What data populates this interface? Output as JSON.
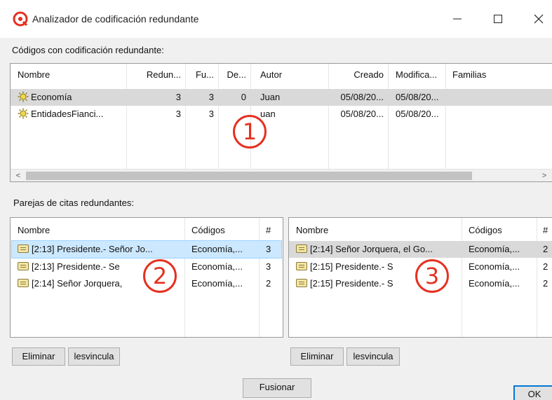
{
  "window": {
    "title": "Analizador de codificación redundante",
    "minimize_icon": "minimize-icon",
    "maximize_icon": "maximize-icon",
    "close_icon": "close-icon",
    "accent_color": "#e53020"
  },
  "codes_section": {
    "label": "Códigos con codificación redundante:",
    "columns": [
      "Nombre",
      "Redun...",
      "Fu...",
      "De...",
      "Autor",
      "Creado",
      "Modifica...",
      "Familias"
    ],
    "rows": [
      {
        "icon": "code-sun-icon",
        "nombre": "Economía",
        "redun": "3",
        "fu": "3",
        "de": "0",
        "autor": "Juan",
        "creado": "05/08/20...",
        "modificado": "05/08/20...",
        "familias": ""
      },
      {
        "icon": "code-sun-icon",
        "nombre": "EntidadesFianci...",
        "redun": "3",
        "fu": "3",
        "de": "",
        "autor": "uan",
        "creado": "05/08/20...",
        "modificado": "05/08/20...",
        "familias": ""
      }
    ]
  },
  "pairs_section": {
    "label": "Parejas de citas redundantes:"
  },
  "left_list": {
    "columns": [
      "Nombre",
      "Códigos",
      "#"
    ],
    "rows": [
      {
        "icon": "quotation-icon",
        "nombre": "[2:13] Presidente.- Señor Jo...",
        "codigos": "Economía,...",
        "count": "3"
      },
      {
        "icon": "quotation-icon",
        "nombre": "[2:13] Presidente.- Se",
        "codigos": "Economía,...",
        "count": "3"
      },
      {
        "icon": "quotation-icon",
        "nombre": "[2:14] Señor Jorquera,",
        "codigos": "Economía,...",
        "count": "2"
      }
    ],
    "delete_label": "Eliminar",
    "unlink_label": "lesvincula"
  },
  "right_list": {
    "columns": [
      "Nombre",
      "Códigos",
      "#"
    ],
    "rows": [
      {
        "icon": "quotation-icon",
        "nombre": "[2:14] Señor Jorquera, el Go...",
        "codigos": "Economía,...",
        "count": "2"
      },
      {
        "icon": "quotation-icon",
        "nombre": "[2:15] Presidente.- S",
        "codigos": "Economía,...",
        "count": "2"
      },
      {
        "icon": "quotation-icon",
        "nombre": "[2:15] Presidente.- S",
        "codigos": "Economía,...",
        "count": "2"
      }
    ],
    "delete_label": "Eliminar",
    "unlink_label": "lesvincula"
  },
  "footer": {
    "merge_label": "Fusionar",
    "ok_label": "OK"
  },
  "callouts": [
    "1",
    "2",
    "3"
  ]
}
